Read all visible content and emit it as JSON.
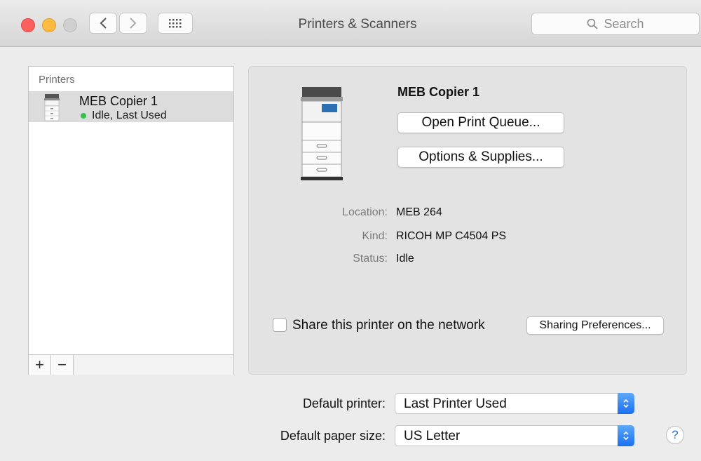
{
  "window": {
    "title": "Printers & Scanners"
  },
  "toolbar": {
    "back_icon": "chevron-left-icon",
    "forward_icon": "chevron-right-icon",
    "grid_icon": "show-all-grid-icon",
    "search_placeholder": "Search"
  },
  "printer_list": {
    "header": "Printers",
    "items": [
      {
        "name": "MEB Copier 1",
        "status": "Idle, Last Used",
        "status_color": "#35c14a"
      }
    ],
    "add_label": "+",
    "remove_label": "−"
  },
  "detail": {
    "name": "MEB Copier 1",
    "open_queue_label": "Open Print Queue...",
    "options_label": "Options & Supplies...",
    "location_label": "Location:",
    "location_value": "MEB 264",
    "kind_label": "Kind:",
    "kind_value": "RICOH MP C4504 PS",
    "status_label": "Status:",
    "status_value": "Idle",
    "share_label": "Share this printer on the network",
    "share_checked": false,
    "sharing_prefs_label": "Sharing Preferences..."
  },
  "defaults": {
    "default_printer_label": "Default printer:",
    "default_printer_value": "Last Printer Used",
    "paper_size_label": "Default paper size:",
    "paper_size_value": "US Letter"
  },
  "help_label": "?",
  "colors": {
    "accent": "#1a6ff1",
    "close": "#fc605c",
    "minimize": "#fdbc40"
  }
}
